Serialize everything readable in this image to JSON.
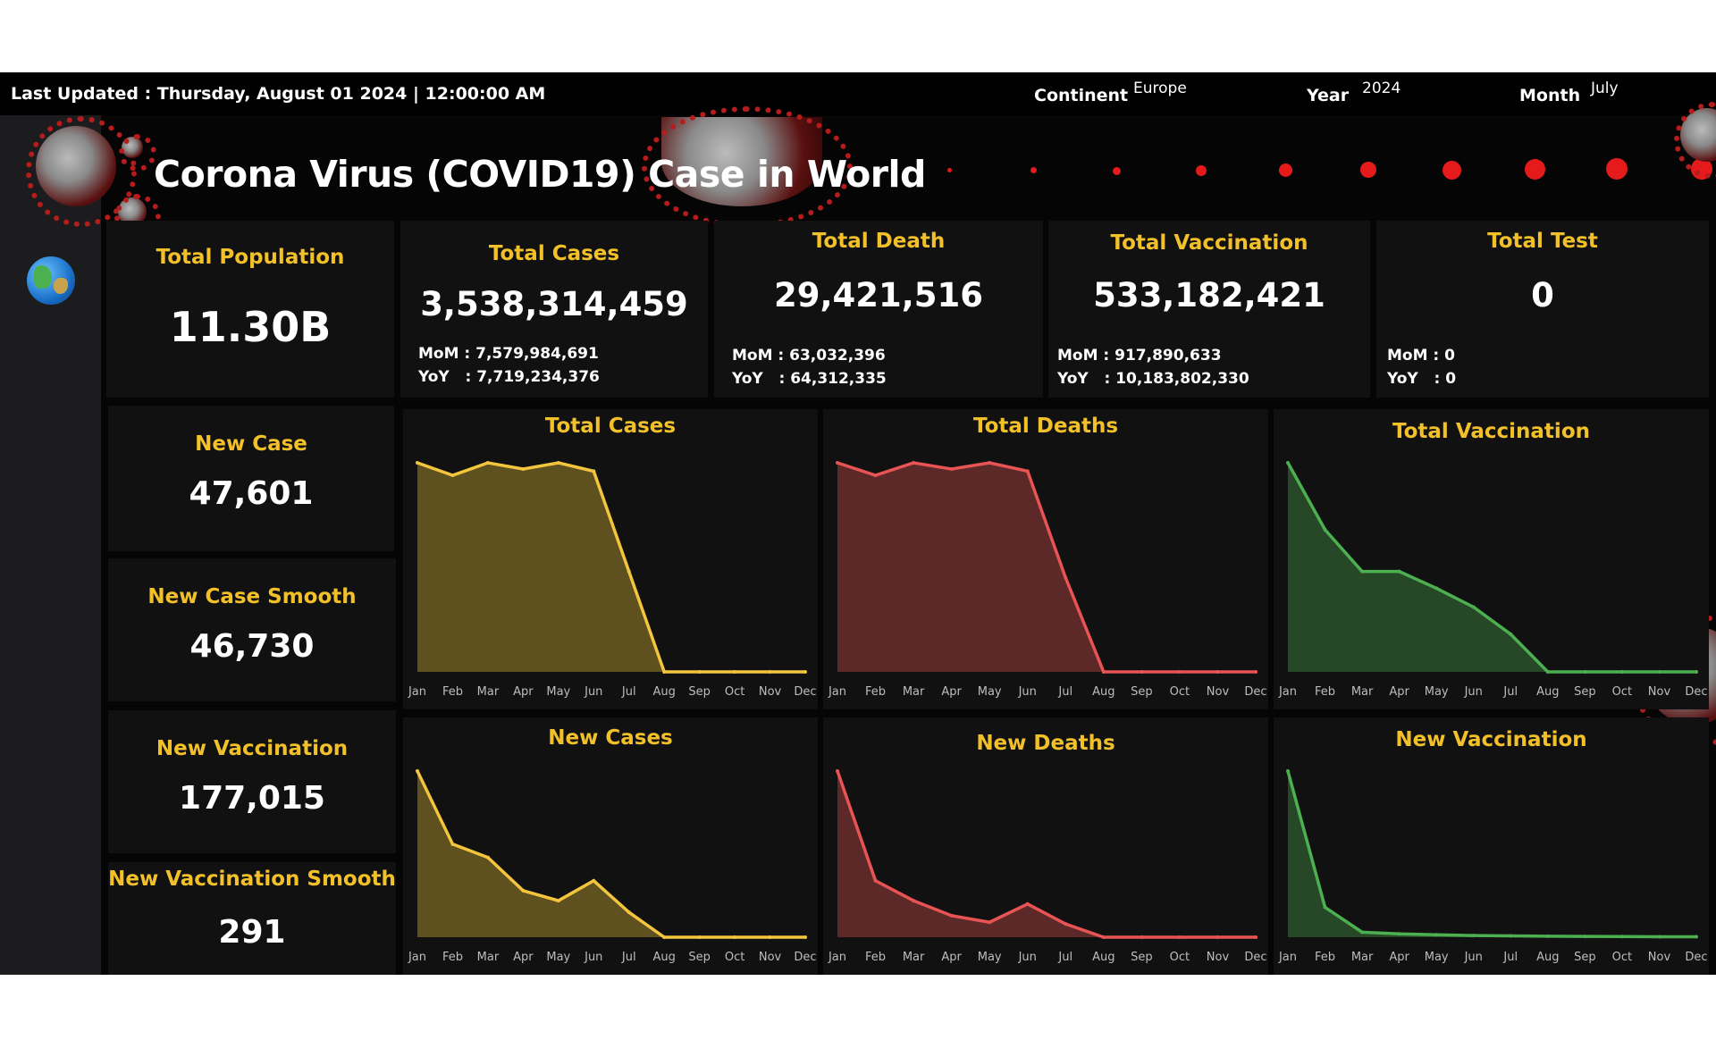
{
  "topbar": {
    "last_updated": "Last Updated : Thursday, August 01 2024 | 12:00:00 AM",
    "continent_label": "Continent",
    "continent_value": "Europe",
    "year_label": "Year",
    "year_value": "2024",
    "month_label": "Month",
    "month_value": "July"
  },
  "title": "Corona Virus (COVID19) Case in World",
  "kpis": {
    "total_population": {
      "title": "Total Population",
      "value": "11.30B"
    },
    "total_cases": {
      "title": "Total Cases",
      "value": "3,538,314,459",
      "mom": "MoM : 7,579,984,691",
      "yoy": "YoY   : 7,719,234,376"
    },
    "total_death": {
      "title": "Total Death",
      "value": "29,421,516",
      "mom": "MoM : 63,032,396",
      "yoy": "YoY   : 64,312,335"
    },
    "total_vaccination": {
      "title": "Total Vaccination",
      "value": "533,182,421",
      "mom": "MoM : 917,890,633",
      "yoy": "YoY   : 10,183,802,330"
    },
    "total_test": {
      "title": "Total Test",
      "value": "0",
      "mom": "MoM : 0",
      "yoy": "YoY   : 0"
    }
  },
  "side_kpis": {
    "new_case": {
      "title": "New Case",
      "value": "47,601"
    },
    "new_case_smooth": {
      "title": "New Case Smooth",
      "value": "46,730"
    },
    "new_vaccination": {
      "title": "New Vaccination",
      "value": "177,015"
    },
    "new_vaccination_smooth": {
      "title": "New Vaccination Smooth",
      "value": "291"
    }
  },
  "colors": {
    "accent": "#f2c029",
    "cases": "#f2c53d",
    "deaths": "#e85454",
    "vaccination": "#4caf50",
    "background": "#050505",
    "card": "#111112"
  },
  "chart_data": [
    {
      "type": "area",
      "title": "Total Cases",
      "color": "#f2c53d",
      "categories": [
        "Jan",
        "Feb",
        "Mar",
        "Apr",
        "May",
        "Jun",
        "Jul",
        "Aug",
        "Sep",
        "Oct",
        "Nov",
        "Dec"
      ],
      "values": [
        100,
        94,
        100,
        97,
        100,
        96,
        48,
        0,
        0,
        0,
        0,
        0
      ]
    },
    {
      "type": "area",
      "title": "Total Deaths",
      "color": "#e85454",
      "categories": [
        "Jan",
        "Feb",
        "Mar",
        "Apr",
        "May",
        "Jun",
        "Jul",
        "Aug",
        "Sep",
        "Oct",
        "Nov",
        "Dec"
      ],
      "values": [
        100,
        94,
        100,
        97,
        100,
        96,
        45,
        0,
        0,
        0,
        0,
        0
      ]
    },
    {
      "type": "area",
      "title": "Total Vaccination",
      "color": "#4caf50",
      "categories": [
        "Jan",
        "Feb",
        "Mar",
        "Apr",
        "May",
        "Jun",
        "Jul",
        "Aug",
        "Sep",
        "Oct",
        "Nov",
        "Dec"
      ],
      "values": [
        100,
        68,
        48,
        48,
        40,
        31,
        18,
        0,
        0,
        0,
        0,
        0
      ]
    },
    {
      "type": "area",
      "title": "New Cases",
      "color": "#f2c53d",
      "categories": [
        "Jan",
        "Feb",
        "Mar",
        "Apr",
        "May",
        "Jun",
        "Jul",
        "Aug",
        "Sep",
        "Oct",
        "Nov",
        "Dec"
      ],
      "values": [
        100,
        56,
        48,
        28,
        22,
        34,
        15,
        0,
        0,
        0,
        0,
        0
      ]
    },
    {
      "type": "area",
      "title": "New Deaths",
      "color": "#e85454",
      "categories": [
        "Jan",
        "Feb",
        "Mar",
        "Apr",
        "May",
        "Jun",
        "Jul",
        "Aug",
        "Sep",
        "Oct",
        "Nov",
        "Dec"
      ],
      "values": [
        100,
        34,
        22,
        13,
        9,
        20,
        8,
        0,
        0,
        0,
        0,
        0
      ]
    },
    {
      "type": "area",
      "title": "New Vaccination",
      "color": "#4caf50",
      "categories": [
        "Jan",
        "Feb",
        "Mar",
        "Apr",
        "May",
        "Jun",
        "Jul",
        "Aug",
        "Sep",
        "Oct",
        "Nov",
        "Dec"
      ],
      "values": [
        100,
        18,
        3,
        2,
        1.5,
        1,
        0.8,
        0.6,
        0.5,
        0.4,
        0.3,
        0.3
      ]
    }
  ]
}
